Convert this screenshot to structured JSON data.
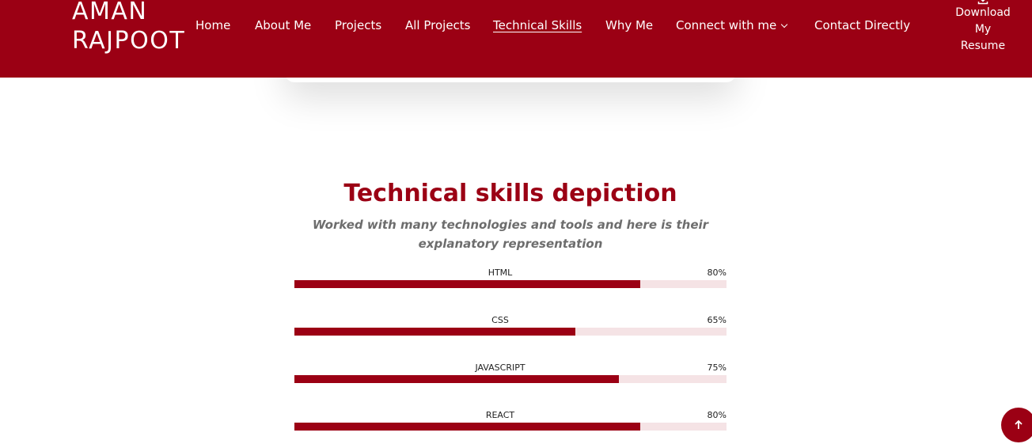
{
  "brand": {
    "line1": "AMAN",
    "line2": "RAJPOOT"
  },
  "nav": {
    "items": [
      "Home",
      "About Me",
      "Projects",
      "All Projects",
      "Technical Skills",
      "Why Me",
      "Connect with me",
      "Contact Directly"
    ],
    "active": "Technical Skills"
  },
  "resume": {
    "line1": "Download",
    "line2": "My",
    "line3": "Resume",
    "icon": "download-icon"
  },
  "section": {
    "title": "Technical skills depiction",
    "subtitle": "Worked with many technologies and tools and here is their explanatory representation"
  },
  "skills": [
    {
      "name": "HTML",
      "label": "80%",
      "percent": 80
    },
    {
      "name": "CSS",
      "label": "65%",
      "percent": 65
    },
    {
      "name": "JAVASCRIPT",
      "label": "75%",
      "percent": 75
    },
    {
      "name": "REACT",
      "label": "80%",
      "percent": 80
    }
  ],
  "colors": {
    "accent": "#9b0014",
    "bar_track": "#f5e3e5"
  },
  "back_to_top": {
    "icon": "arrow-up-icon"
  }
}
